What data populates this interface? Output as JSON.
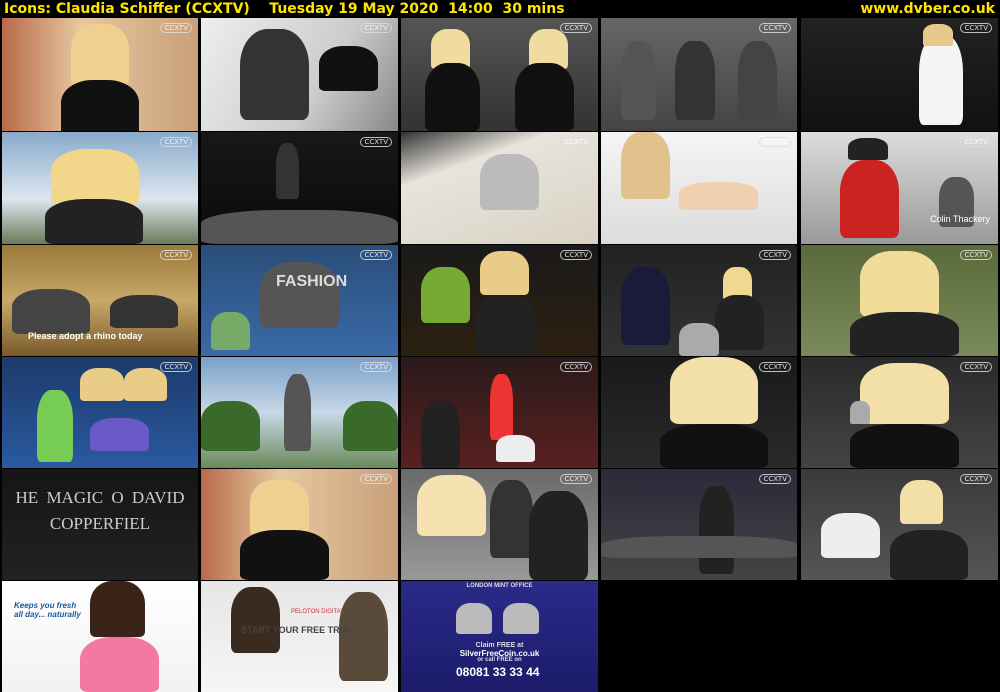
{
  "header": {
    "title": "Icons: Claudia Schiffer (CCXTV)    Tuesday 19 May 2020  14:00  30 mins",
    "site": "www.dvber.co.uk"
  },
  "colors": {
    "header_text": "#ffe600",
    "background": "#000000"
  },
  "channel_logo": "CCXTV",
  "thumbnails": [
    {
      "name": "thumb-interview-sofa",
      "caption": ""
    },
    {
      "name": "thumb-autograph-photo",
      "caption": ""
    },
    {
      "name": "thumb-runway-black",
      "caption": ""
    },
    {
      "name": "thumb-runway-suits",
      "caption": ""
    },
    {
      "name": "thumb-runway-letters-dress",
      "caption": ""
    },
    {
      "name": "thumb-interview-balcony",
      "caption": ""
    },
    {
      "name": "thumb-runway-dark",
      "caption": ""
    },
    {
      "name": "thumb-sketch-drawing",
      "caption": ""
    },
    {
      "name": "thumb-hand-ad",
      "caption": ""
    },
    {
      "name": "thumb-chelsea-pensioner",
      "caption": "Colin Thackery"
    },
    {
      "name": "thumb-rhino-ad",
      "caption": "Please adopt a rhino today"
    },
    {
      "name": "thumb-fashion-building",
      "caption": "FASHION"
    },
    {
      "name": "thumb-harrods-signing",
      "caption": ""
    },
    {
      "name": "thumb-press-conference",
      "caption": ""
    },
    {
      "name": "thumb-interview-table",
      "caption": ""
    },
    {
      "name": "thumb-dolls-launch",
      "caption": ""
    },
    {
      "name": "thumb-victory-column",
      "caption": ""
    },
    {
      "name": "thumb-premiere-red",
      "caption": ""
    },
    {
      "name": "thumb-closeup-premiere",
      "caption": ""
    },
    {
      "name": "thumb-closeup-mic",
      "caption": ""
    },
    {
      "name": "thumb-magic-sign",
      "caption": "HE MAGIC O DAVID COPPERFIEL"
    },
    {
      "name": "thumb-interview-sofa-2",
      "caption": ""
    },
    {
      "name": "thumb-premiere-crowd",
      "caption": ""
    },
    {
      "name": "thumb-premiere-street",
      "caption": ""
    },
    {
      "name": "thumb-crowd-scarf",
      "caption": ""
    },
    {
      "name": "thumb-deodorant-ad",
      "caption": "Keeps you fresh all day... naturally"
    },
    {
      "name": "thumb-peloton-ad",
      "caption": "START YOUR FREE TRIAL"
    },
    {
      "name": "thumb-coin-ad",
      "caption": "08081 33 33 44"
    }
  ],
  "ad_texts": {
    "peloton_brand": "PELOTON DIGITAL",
    "coin_brand": "LONDON MINT OFFICE",
    "coin_site": "SilverFreeCoin.co.uk",
    "coin_claim": "Claim FREE at",
    "coin_or": "or call FREE on"
  }
}
